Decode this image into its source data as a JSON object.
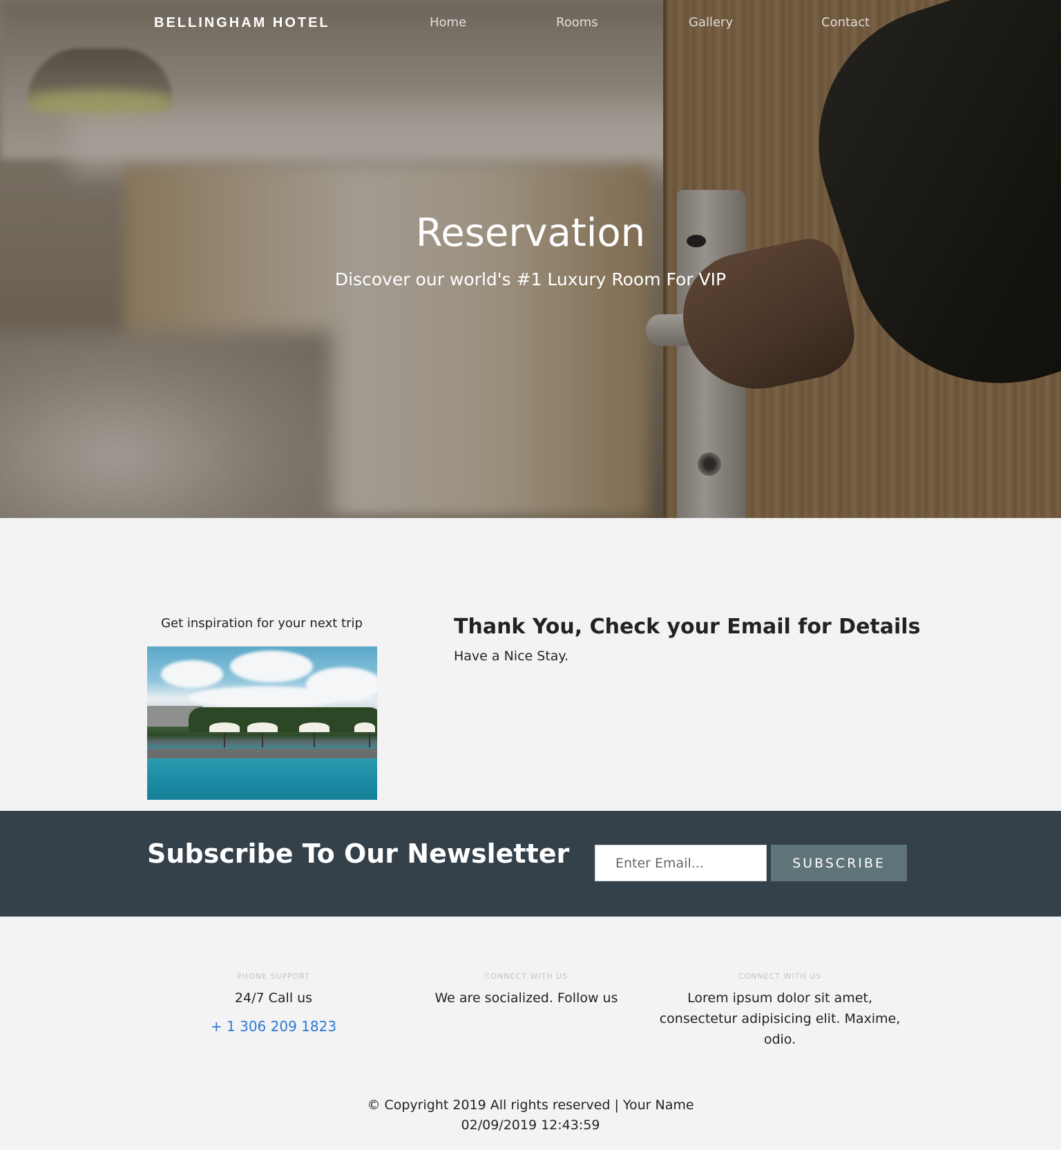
{
  "nav": {
    "brand": "BELLINGHAM HOTEL",
    "links": [
      "Home",
      "Rooms",
      "Gallery",
      "Contact"
    ]
  },
  "hero": {
    "title": "Reservation",
    "subtitle": "Discover our world's #1 Luxury Room For VIP"
  },
  "content": {
    "inspiration_caption": "Get inspiration for your next trip",
    "thanks_title": "Thank You, Check your Email for Details",
    "thanks_subtitle": "Have a Nice Stay."
  },
  "newsletter": {
    "title": "Subscribe To Our Newsletter",
    "email_placeholder": "Enter Email...",
    "button_label": "SUBSCRIBE"
  },
  "footer": {
    "columns": [
      {
        "heading": "PHONE SUPPORT",
        "text": "24/7 Call us",
        "link": "+ 1 306 209 1823"
      },
      {
        "heading": "CONNECT WITH US",
        "text": "We are socialized. Follow us"
      },
      {
        "heading": "CONNECT WITH US",
        "text": "Lorem ipsum dolor sit amet, consectetur adipisicing elit. Maxime, odio."
      }
    ],
    "copyright": "© Copyright 2019 All rights reserved | Your Name",
    "timestamp": "02/09/2019 12:43:59"
  },
  "colors": {
    "newsletter_bg": "#34414b",
    "subscribe_button": "#5f7479",
    "phone_link": "#2e78d6",
    "page_bg": "#f3f3f3"
  }
}
